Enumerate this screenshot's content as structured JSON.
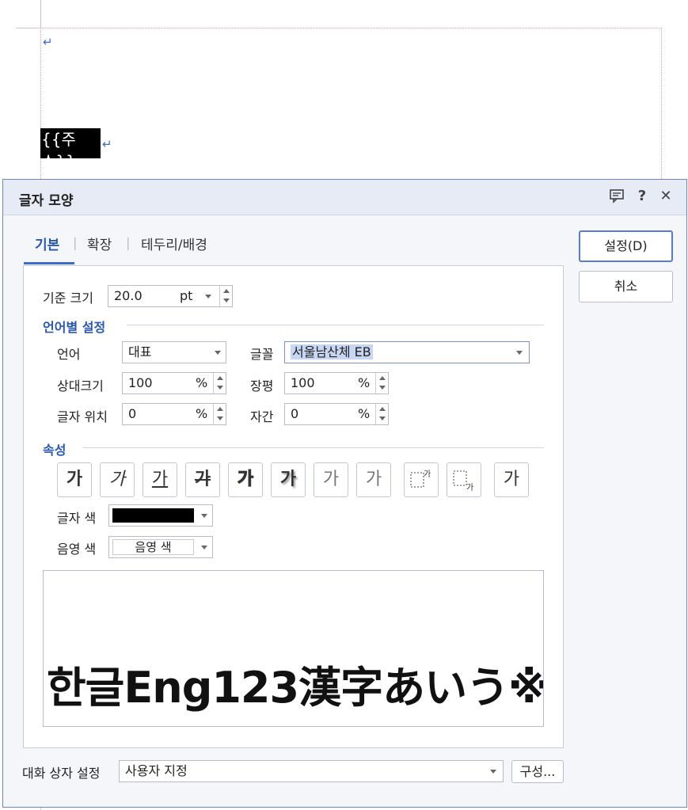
{
  "document": {
    "field_text": "{{주소}}",
    "para_mark": "↵"
  },
  "dialog": {
    "title": "글자 모양",
    "titlebar_icons": [
      "comment-icon",
      "help-icon",
      "close-icon"
    ],
    "help_glyph": "?",
    "close_glyph": "✕",
    "tabs": [
      {
        "label": "기본",
        "active": true
      },
      {
        "label": "확장",
        "active": false
      },
      {
        "label": "테두리/배경",
        "active": false
      }
    ],
    "tab_separator": "|",
    "base_size": {
      "label": "기준 크기",
      "value": "20.0",
      "unit": "pt"
    },
    "lang_section": {
      "title": "언어별 설정",
      "language": {
        "label": "언어",
        "value": "대표"
      },
      "font": {
        "label": "글꼴",
        "value": "서울남산체 EB"
      },
      "relative_size": {
        "label": "상대크기",
        "value": "100",
        "unit": "%"
      },
      "width_ratio": {
        "label": "장평",
        "value": "100",
        "unit": "%"
      },
      "char_position": {
        "label": "글자 위치",
        "value": "0",
        "unit": "%"
      },
      "spacing": {
        "label": "자간",
        "value": "0",
        "unit": "%"
      }
    },
    "attr_section": {
      "title": "속성",
      "buttons": [
        "가",
        "가",
        "가",
        "가",
        "가",
        "가",
        "가",
        "가",
        "가",
        "가",
        "가"
      ],
      "text_color": {
        "label": "글자 색",
        "color": "#000000"
      },
      "shade_color": {
        "label": "음영 색",
        "value": "음영 색"
      }
    },
    "preview_text": "한글Eng123漢字あいう※",
    "footer": {
      "label": "대화 상자 설정",
      "value": "사용자 지정",
      "config_button": "구성..."
    },
    "buttons": {
      "ok": "설정(D)",
      "cancel": "취소"
    }
  }
}
